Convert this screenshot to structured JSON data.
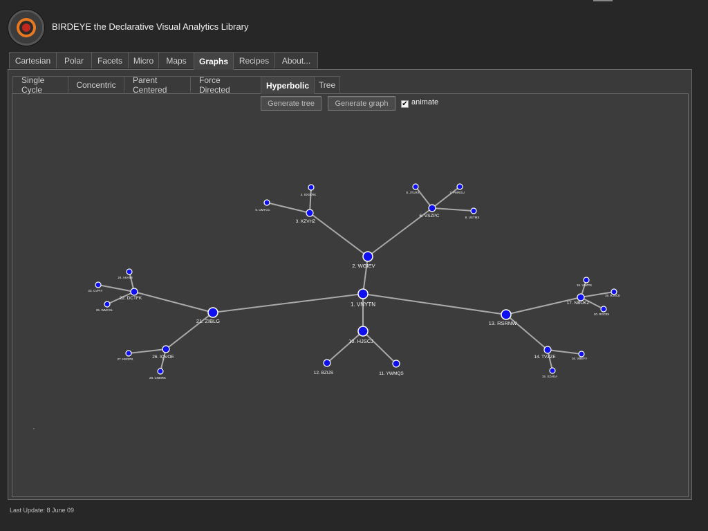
{
  "app": {
    "title": "BIRDEYE the Declarative Visual Analytics Library"
  },
  "main_tabs": [
    "Cartesian",
    "Polar",
    "Facets",
    "Micro",
    "Maps",
    "Graphs",
    "Recipes",
    "About..."
  ],
  "main_tab_active": "Graphs",
  "sub_tabs": [
    "Single Cycle",
    "Concentric",
    "Parent Centered",
    "Force Directed",
    "Hyperbolic",
    "Tree"
  ],
  "sub_tab_active": "Hyperbolic",
  "controls": {
    "generate_tree_label": "Generate tree",
    "generate_graph_label": "Generate graph",
    "animate_label": "animate",
    "animate_checked": true
  },
  "graph": {
    "node_color": "#1010ee",
    "edge_color": "#aaaaaa",
    "nodes": [
      {
        "id": 1,
        "label": "1. VNYTN",
        "level": 0
      },
      {
        "id": 2,
        "label": "2. WGIEV",
        "level": 1
      },
      {
        "id": 3,
        "label": "3. KZVHZ",
        "level": 2
      },
      {
        "id": 4,
        "label": "4. IOGERK",
        "level": 3
      },
      {
        "id": 5,
        "label": "5. UMTCC",
        "level": 3
      },
      {
        "id": 6,
        "label": "6. VSZPC",
        "level": 2
      },
      {
        "id": 7,
        "label": "7. PMRGU",
        "level": 3
      },
      {
        "id": 8,
        "label": "8. JTUXX",
        "level": 3
      },
      {
        "id": 9,
        "label": "9. USTMS",
        "level": 3
      },
      {
        "id": 10,
        "label": "10. HJSCJ",
        "level": 1
      },
      {
        "id": 11,
        "label": "11. YWMQS",
        "level": 2
      },
      {
        "id": 12,
        "label": "12. BZIJS",
        "level": 2
      },
      {
        "id": 13,
        "label": "13. RSRNW",
        "level": 1
      },
      {
        "id": 14,
        "label": "14. TVZZE",
        "level": 2
      },
      {
        "id": 15,
        "label": "15. XZAEA",
        "level": 3
      },
      {
        "id": 16,
        "label": "16. VBEFV",
        "level": 3
      },
      {
        "id": 17,
        "label": "17. NBUKZ",
        "level": 2
      },
      {
        "id": 18,
        "label": "18. VSZPE",
        "level": 3
      },
      {
        "id": 19,
        "label": "19. RJACE",
        "level": 3
      },
      {
        "id": 20,
        "label": "20. RGODI",
        "level": 3
      },
      {
        "id": 21,
        "label": "21. ZIBLG",
        "level": 1
      },
      {
        "id": 22,
        "label": "22. DCTFK",
        "level": 2
      },
      {
        "id": 23,
        "label": "23. CVPIY",
        "level": 3
      },
      {
        "id": 24,
        "label": "24. AKAIM",
        "level": 3
      },
      {
        "id": 25,
        "label": "25. WMCXL",
        "level": 3
      },
      {
        "id": 26,
        "label": "26. IQVOE",
        "level": 2
      },
      {
        "id": 27,
        "label": "27. KEDPS",
        "level": 3
      },
      {
        "id": 28,
        "label": "28. CNMRK",
        "level": 3
      }
    ],
    "edges": [
      [
        1,
        2
      ],
      [
        1,
        10
      ],
      [
        1,
        13
      ],
      [
        1,
        21
      ],
      [
        2,
        3
      ],
      [
        2,
        6
      ],
      [
        3,
        4
      ],
      [
        3,
        5
      ],
      [
        6,
        7
      ],
      [
        6,
        8
      ],
      [
        6,
        9
      ],
      [
        10,
        11
      ],
      [
        10,
        12
      ],
      [
        13,
        14
      ],
      [
        13,
        17
      ],
      [
        14,
        15
      ],
      [
        14,
        16
      ],
      [
        17,
        18
      ],
      [
        17,
        19
      ],
      [
        17,
        20
      ],
      [
        21,
        22
      ],
      [
        21,
        26
      ],
      [
        22,
        23
      ],
      [
        22,
        24
      ],
      [
        22,
        25
      ],
      [
        26,
        27
      ],
      [
        26,
        28
      ]
    ]
  },
  "footer": {
    "last_update": "Last Update: 8 June 09"
  }
}
